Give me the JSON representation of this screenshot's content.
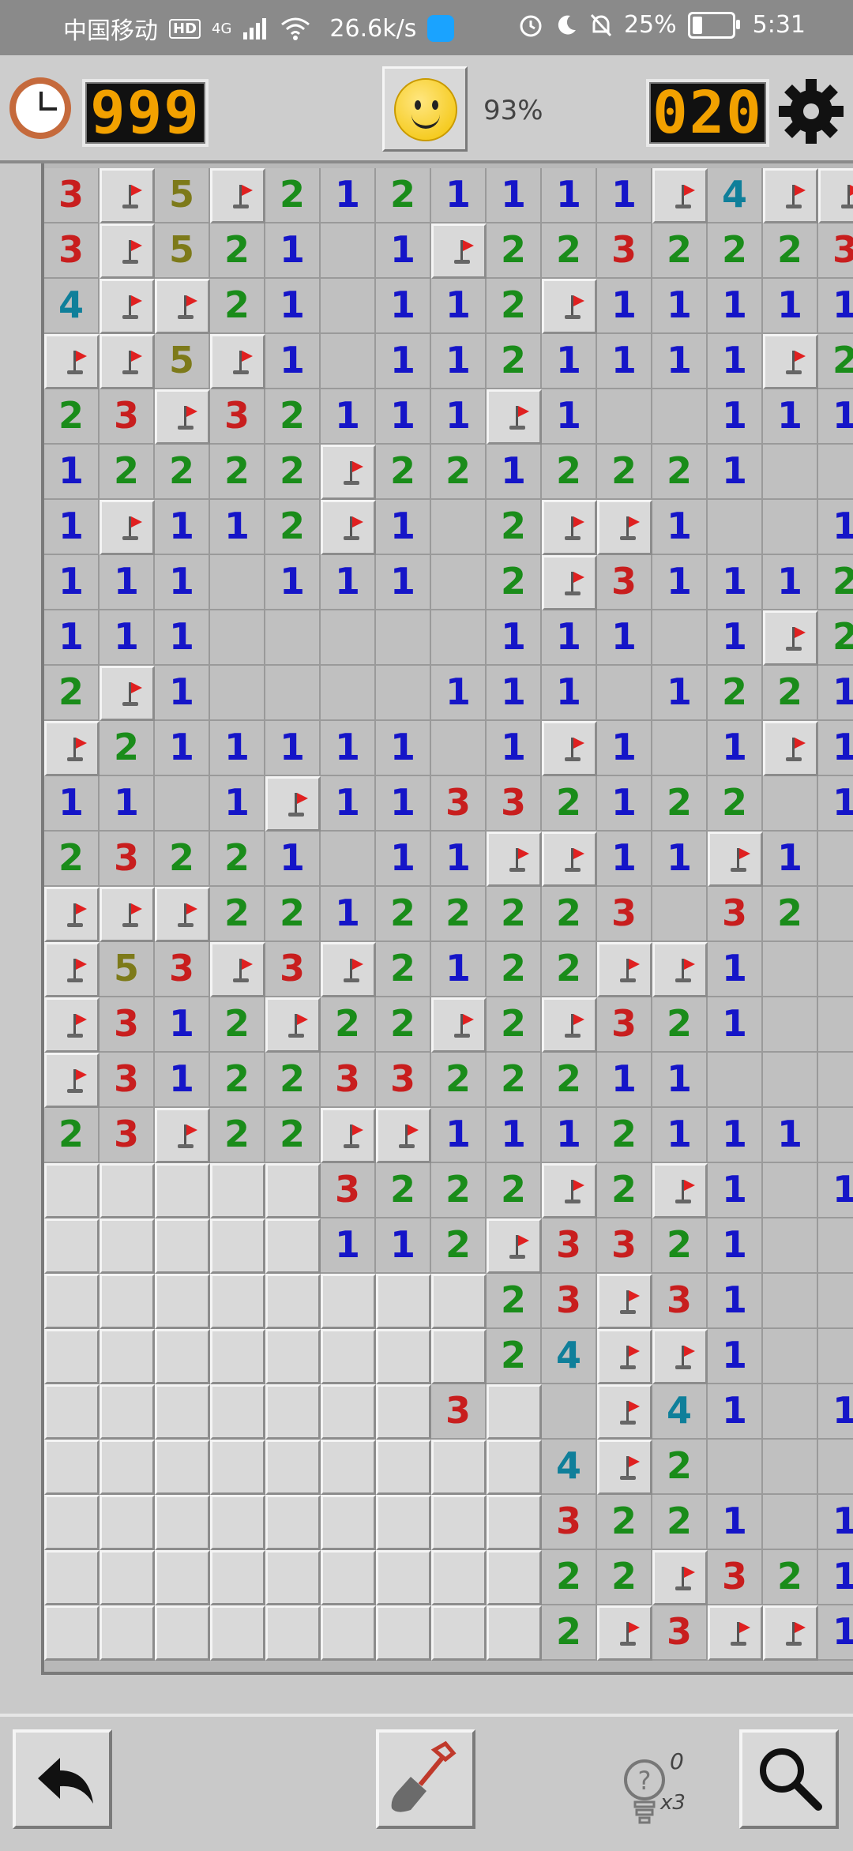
{
  "status_bar": {
    "carrier": "中国移动",
    "hd": "HD",
    "network": "4G",
    "speed": "26.6k/s",
    "battery": "25%",
    "time": "5:31",
    "icons": [
      "alarm-icon",
      "moon-icon",
      "mute-bell-icon",
      "battery-icon",
      "wifi-icon",
      "signal-icon"
    ]
  },
  "header": {
    "timer": "999",
    "mine_counter": "020",
    "percent": "93%",
    "icons": [
      "clock-icon",
      "smiley-icon",
      "gear-icon"
    ]
  },
  "board": {
    "cols": 15,
    "rows": 27,
    "cell_legend": {
      "H": "unrevealed",
      "F": "flag",
      ".": "empty revealed",
      "1-8": "number"
    },
    "rows_data": [
      "3F5F2121111F4FF",
      "3F521.1F2232223",
      "4FF21.112F11111",
      "FF5F1.1121111F2",
      "23F32111F1..1111",
      "12222F2212221..1",
      "1F112F1.2FF1..1",
      "111.111.2F31112",
      "111.....111.1F2",
      "2F1....111.1221",
      "F211111.1F1.1F1.",
      "11.1F11332122 1.",
      "23221 11FF11F1..",
      "FFF22122223 32..",
      "F53F3F2122FF1..",
      "F312F22F2F321..",
      "F31223322211...1",
      "23F22FF1112111.1",
      "HHHHH3222F2F1.1",
      "HHHHH112F3321..",
      "HHHHHHHH23F31..",
      "HHHHHHHH24FF1..",
      "HHHHHHH3H.F41.1",
      "HHHHHHHHH4F2...1",
      "HHHHHHHHH3221.1",
      "HHHHHHHHH22F321",
      "HHHHHHHHH2F3FF1"
    ]
  },
  "toolbar": {
    "hint_count": "0",
    "hint_multiplier": "x3",
    "icons": [
      "undo-icon",
      "shovel-icon",
      "lightbulb-hint-icon",
      "magnifier-icon"
    ]
  }
}
